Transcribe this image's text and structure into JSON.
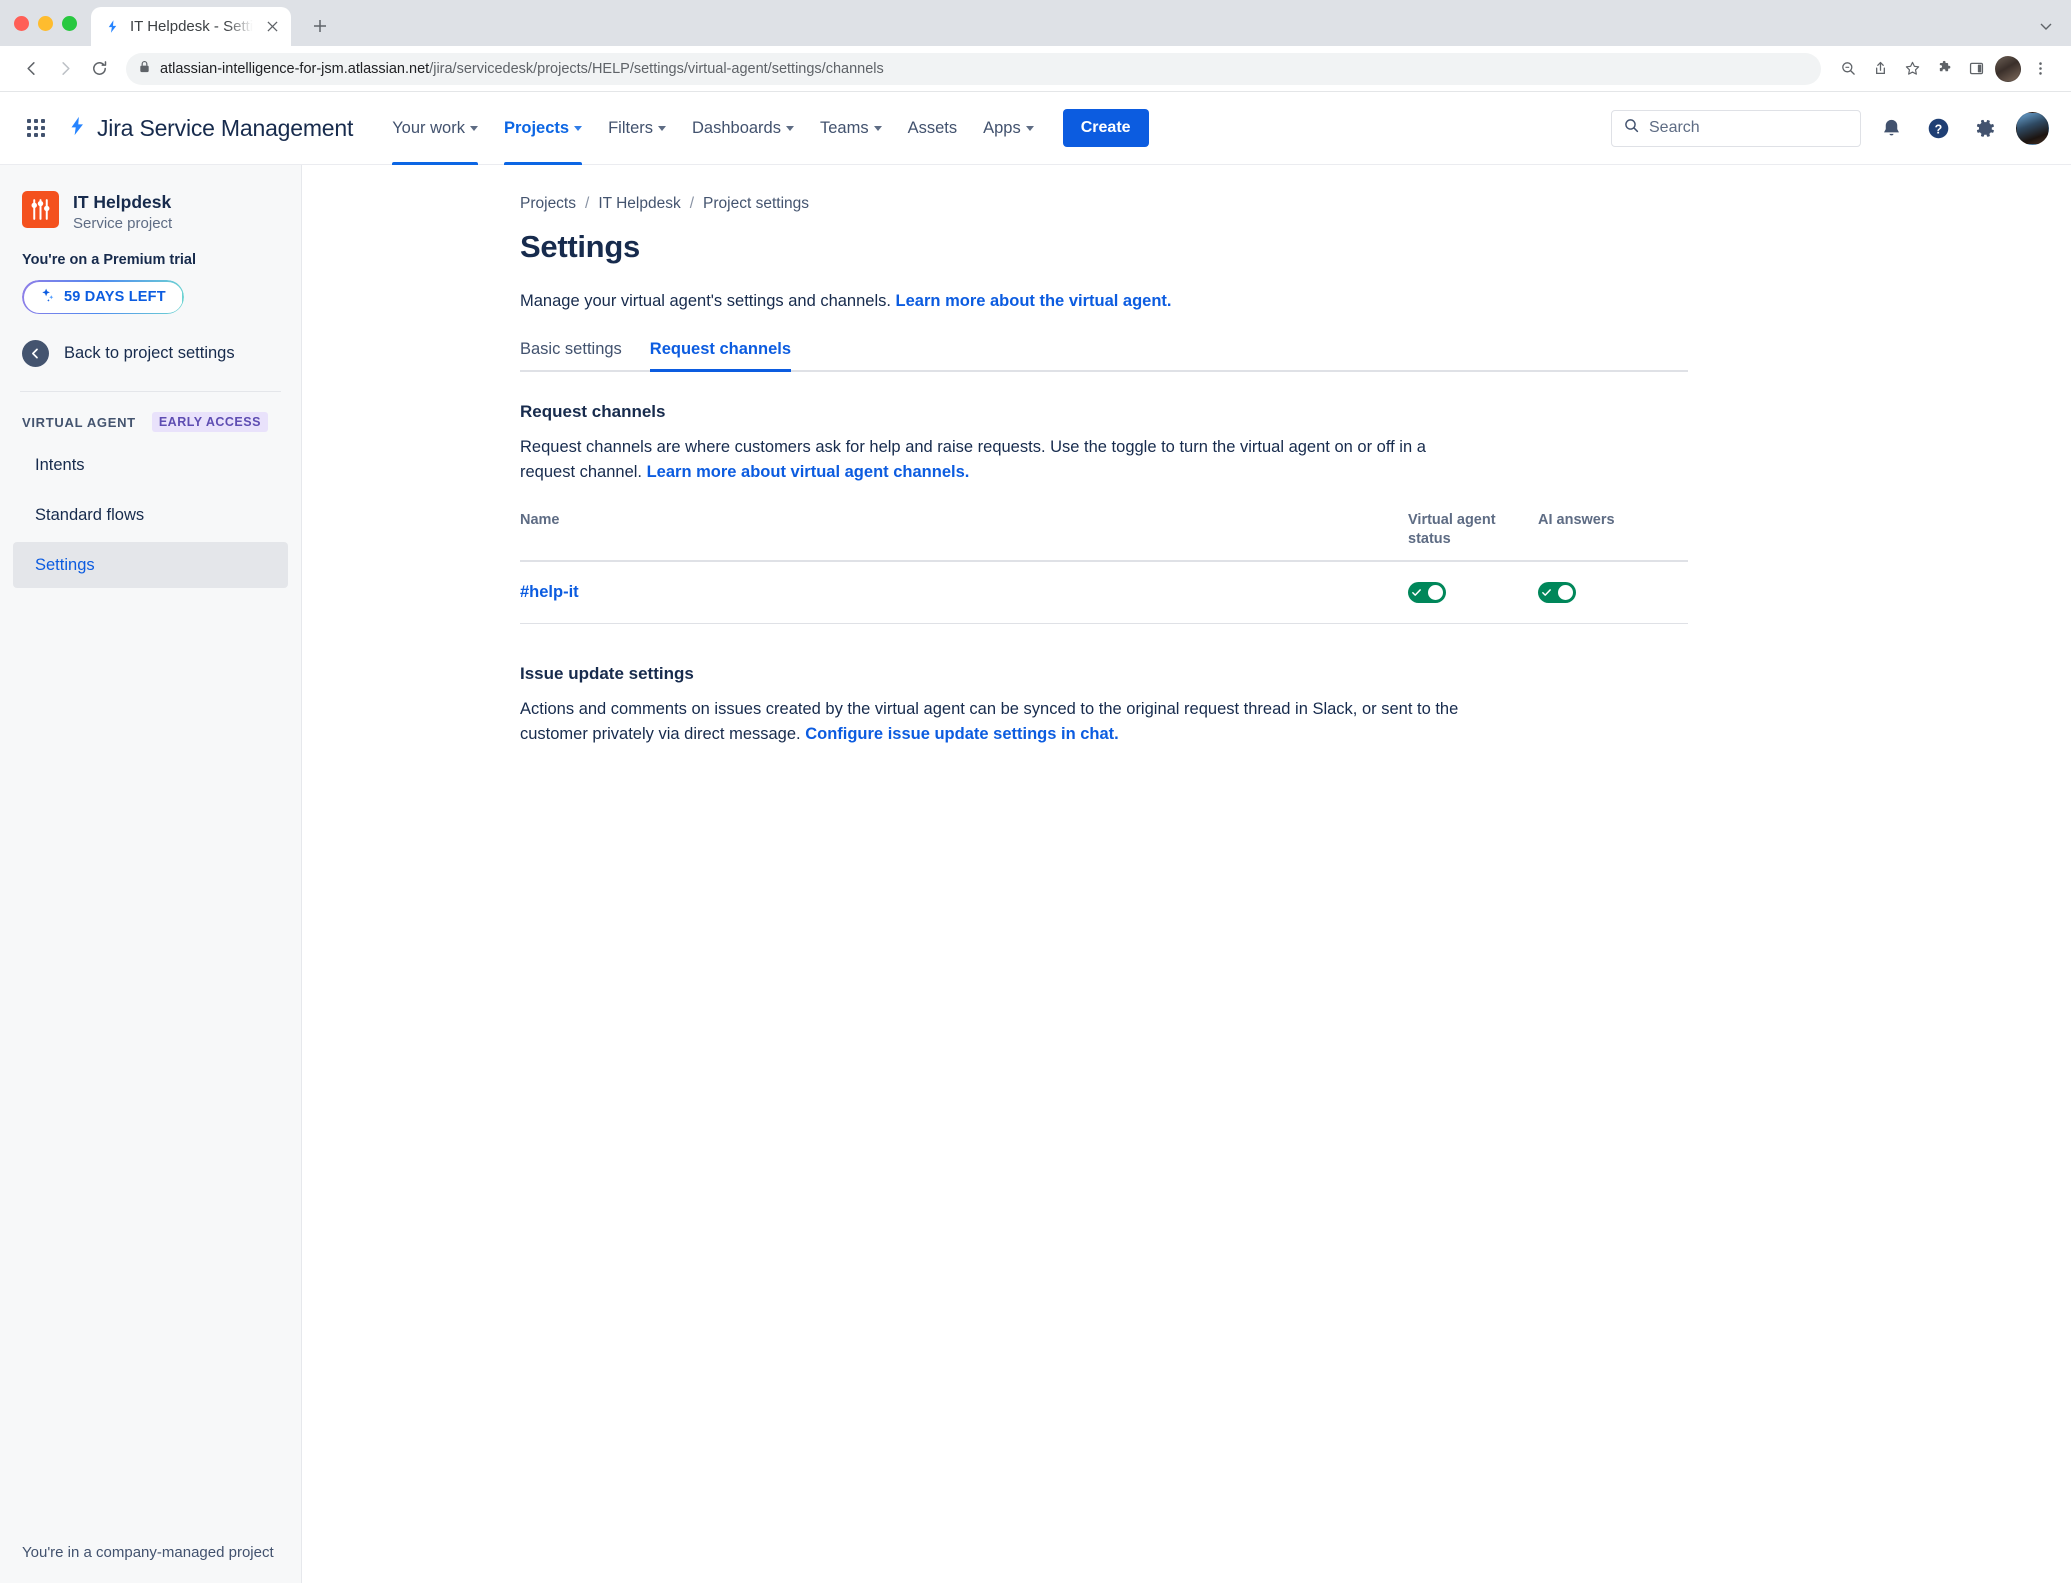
{
  "browser": {
    "tab_title": "IT Helpdesk - Settings - Servic",
    "url_host": "atlassian-intelligence-for-jsm.atlassian.net",
    "url_path": "/jira/servicedesk/projects/HELP/settings/virtual-agent/settings/channels",
    "new_tab_label": "+",
    "close_label": "×"
  },
  "nav": {
    "brand": "Jira Service Management",
    "items": [
      {
        "label": "Your work",
        "has_caret": true,
        "active": false
      },
      {
        "label": "Projects",
        "has_caret": true,
        "active": true
      },
      {
        "label": "Filters",
        "has_caret": true,
        "active": false
      },
      {
        "label": "Dashboards",
        "has_caret": true,
        "active": false
      },
      {
        "label": "Teams",
        "has_caret": true,
        "active": false
      },
      {
        "label": "Assets",
        "has_caret": false,
        "active": false
      },
      {
        "label": "Apps",
        "has_caret": true,
        "active": false
      }
    ],
    "create_label": "Create",
    "search_placeholder": "Search",
    "accent_color": "#0c5ce0"
  },
  "sidebar": {
    "project_name": "IT Helpdesk",
    "project_type": "Service project",
    "trial_label": "You're on a Premium trial",
    "trial_days": "59 DAYS LEFT",
    "back_label": "Back to project settings",
    "section_title": "VIRTUAL AGENT",
    "section_badge": "EARLY ACCESS",
    "items": [
      {
        "label": "Intents",
        "active": false
      },
      {
        "label": "Standard flows",
        "active": false
      },
      {
        "label": "Settings",
        "active": true
      }
    ],
    "footer": "You're in a company-managed project"
  },
  "main": {
    "breadcrumb": [
      "Projects",
      "IT Helpdesk",
      "Project settings"
    ],
    "breadcrumb_separator": "/",
    "page_title": "Settings",
    "intro_text": "Manage your virtual agent's settings and channels. ",
    "intro_link": "Learn more about the virtual agent.",
    "tabs": [
      {
        "label": "Basic settings",
        "active": false
      },
      {
        "label": "Request channels",
        "active": true
      }
    ],
    "request_channels": {
      "title": "Request channels",
      "body": "Request channels are where customers ask for help and raise requests. Use the toggle to turn the virtual agent on or off in a request channel. ",
      "link": "Learn more about virtual agent channels."
    },
    "table": {
      "columns": [
        "Name",
        "Virtual agent status",
        "AI answers"
      ],
      "rows": [
        {
          "name": "#help-it",
          "virtual_agent_status": true,
          "ai_answers": true
        }
      ]
    },
    "issue_update": {
      "title": "Issue update settings",
      "body": "Actions and comments on issues created by the virtual agent can be synced to the original request thread in Slack, or sent to the customer privately via direct message. ",
      "link": "Configure issue update settings in chat."
    }
  },
  "colors": {
    "toggle_on": "#00875a",
    "link": "#0c5ce0",
    "project_icon": "#f4511e"
  }
}
